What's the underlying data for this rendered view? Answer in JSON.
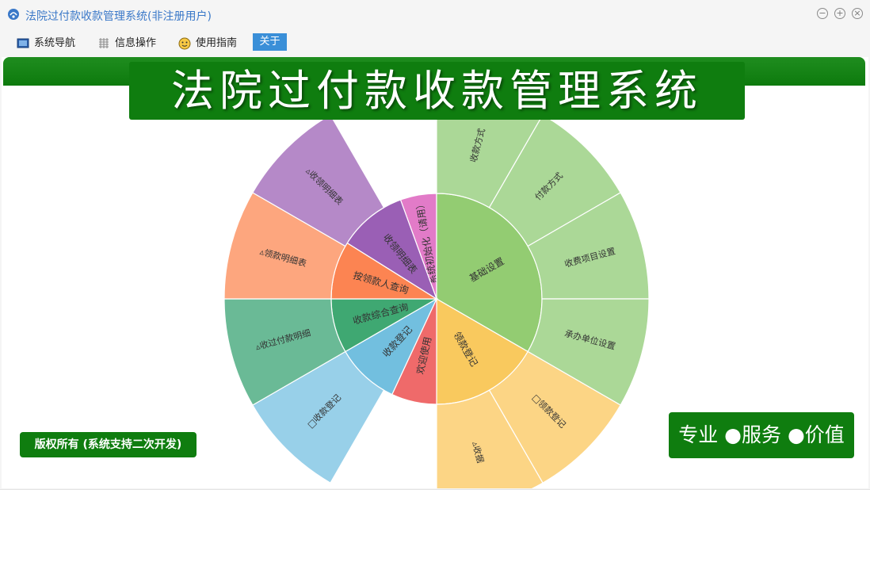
{
  "window": {
    "title": "法院过付款收款管理系统(非注册用户)",
    "controls": [
      {
        "name": "minimize",
        "glyph": "−"
      },
      {
        "name": "maximize",
        "glyph": "+"
      },
      {
        "name": "close",
        "glyph": "×"
      }
    ]
  },
  "menu": {
    "items": [
      {
        "label": "系统导航",
        "icon": "monitor-icon"
      },
      {
        "label": "信息操作",
        "icon": "grid-icon"
      },
      {
        "label": "使用指南",
        "icon": "smiley-icon"
      },
      {
        "label": "关于",
        "icon": "",
        "selected": true
      }
    ]
  },
  "banner": {
    "title": "法院过付款收款管理系统"
  },
  "sunburst": {
    "inner": [
      {
        "label": "系统初始化（请用）",
        "color": "#e27bc8",
        "start": -20,
        "end": 0
      },
      {
        "label": "基础设置",
        "color": "#93cc72",
        "start": 0,
        "end": 120
      },
      {
        "label": "领款登记",
        "color": "#f9c95e",
        "start": 120,
        "end": 180
      },
      {
        "label": "欢迎使用",
        "color": "#ef6a6a",
        "start": 180,
        "end": 205
      },
      {
        "label": "收款登记",
        "color": "#72bfdf",
        "start": 205,
        "end": 240
      },
      {
        "label": "收款综合查询",
        "color": "#3fa872",
        "start": 240,
        "end": 270
      },
      {
        "label": "按领款人查询",
        "color": "#fc8452",
        "start": 270,
        "end": 302
      },
      {
        "label": "收领明细表",
        "color": "#9a5fb5",
        "start": 302,
        "end": 340
      }
    ],
    "outer": [
      {
        "label": "收款方式",
        "color": "#abd897",
        "start": 0,
        "end": 30
      },
      {
        "label": "付款方式",
        "color": "#abd897",
        "start": 30,
        "end": 60
      },
      {
        "label": "收费项目设置",
        "color": "#abd897",
        "start": 60,
        "end": 90
      },
      {
        "label": "承办单位设置",
        "color": "#abd897",
        "start": 90,
        "end": 120
      },
      {
        "label": "□领款登记",
        "color": "#fcd585",
        "start": 120,
        "end": 150
      },
      {
        "label": "▵收据",
        "color": "#fcd585",
        "start": 150,
        "end": 180
      },
      {
        "label": "□收款登记",
        "color": "#98d0e9",
        "start": 210,
        "end": 240
      },
      {
        "label": "▵收过付款明细",
        "color": "#6aba96",
        "start": 240,
        "end": 270
      },
      {
        "label": "▵领款明细表",
        "color": "#fda67e",
        "start": 270,
        "end": 300
      },
      {
        "label": "▵收领明细表",
        "color": "#b589c8",
        "start": 300,
        "end": 330
      }
    ]
  },
  "footer": {
    "copyright": "版权所有 (系统支持二次开发)",
    "motto": "专业 ●服务 ●价值"
  }
}
